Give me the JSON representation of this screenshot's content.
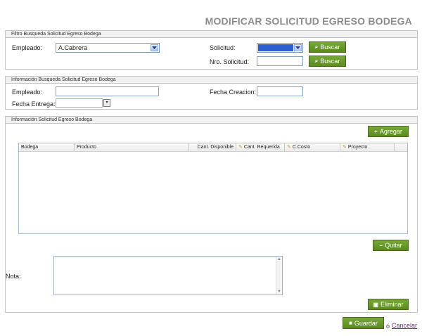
{
  "page": {
    "title": "MODIFICAR SOLICITUD EGRESO BODEGA"
  },
  "filtro": {
    "header": "Filtro Busqueda Solicitud Egreso Bodega",
    "empleado_label": "Empleado:",
    "empleado_value": "A.Cabrera",
    "solicitud_label": "Solicitud:",
    "solicitud_value": "",
    "nro_label": "Nro. Solicitud:",
    "nro_value": "",
    "buscar1_label": "Buscar",
    "buscar2_label": "Buscar"
  },
  "info": {
    "header": "Información Busqueda Solicitud Egreso Bodega",
    "empleado_label": "Empleado:",
    "empleado_value": "",
    "fecha_creacion_label": "Fecha Creacion:",
    "fecha_creacion_value": "",
    "fecha_entrega_label": "Fecha Entrega:",
    "fecha_entrega_value": ""
  },
  "detalle": {
    "header": "Información Solicitud Egreso Bodega",
    "agregar_label": "Agregar",
    "quitar_label": "Quitar",
    "eliminar_label": "Eliminar",
    "nota_label": "Nota:",
    "nota_value": "",
    "columns": {
      "bodega": "Bodega",
      "producto": "Producto",
      "cant_disponible": "Cant. Disponible",
      "cant_requerida": "Cant. Requerida",
      "ccosto": "C.Costo",
      "proyecto": "Proyecto"
    }
  },
  "footer": {
    "guardar_label": "Guardar",
    "or_text": "ó",
    "cancelar_label": "Cancelar"
  },
  "colors": {
    "accent": "#5a8a1f",
    "title": "#8c8c8c",
    "link": "#7b2a8c",
    "select_highlight": "#2f5fcf"
  }
}
